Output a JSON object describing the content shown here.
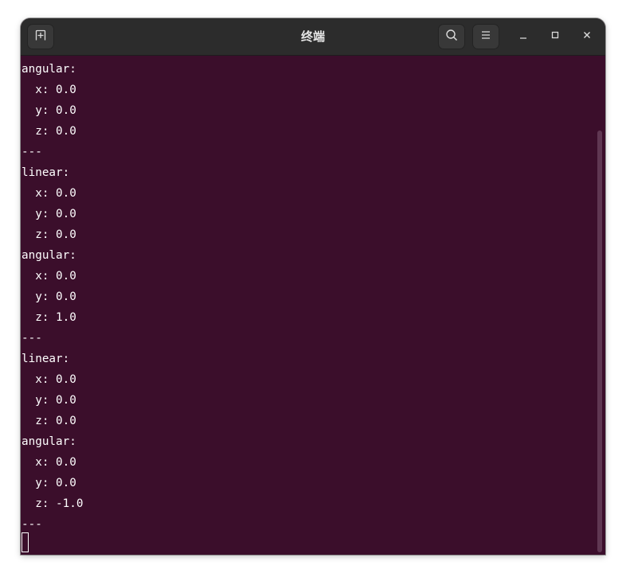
{
  "window": {
    "title": "终端"
  },
  "titlebar": {
    "new_tab_icon": "new-tab-icon",
    "search_icon": "search-icon",
    "menu_icon": "hamburger-menu-icon",
    "minimize_icon": "minimize-icon",
    "maximize_icon": "maximize-icon",
    "close_icon": "close-icon"
  },
  "terminal": {
    "background": "#3b0e2b",
    "foreground": "#ffffff",
    "lines": [
      "angular:",
      "  x: 0.0",
      "  y: 0.0",
      "  z: 0.0",
      "---",
      "linear:",
      "  x: 0.0",
      "  y: 0.0",
      "  z: 0.0",
      "angular:",
      "  x: 0.0",
      "  y: 0.0",
      "  z: 1.0",
      "---",
      "linear:",
      "  x: 0.0",
      "  y: 0.0",
      "  z: 0.0",
      "angular:",
      "  x: 0.0",
      "  y: 0.0",
      "  z: -1.0",
      "---"
    ]
  }
}
